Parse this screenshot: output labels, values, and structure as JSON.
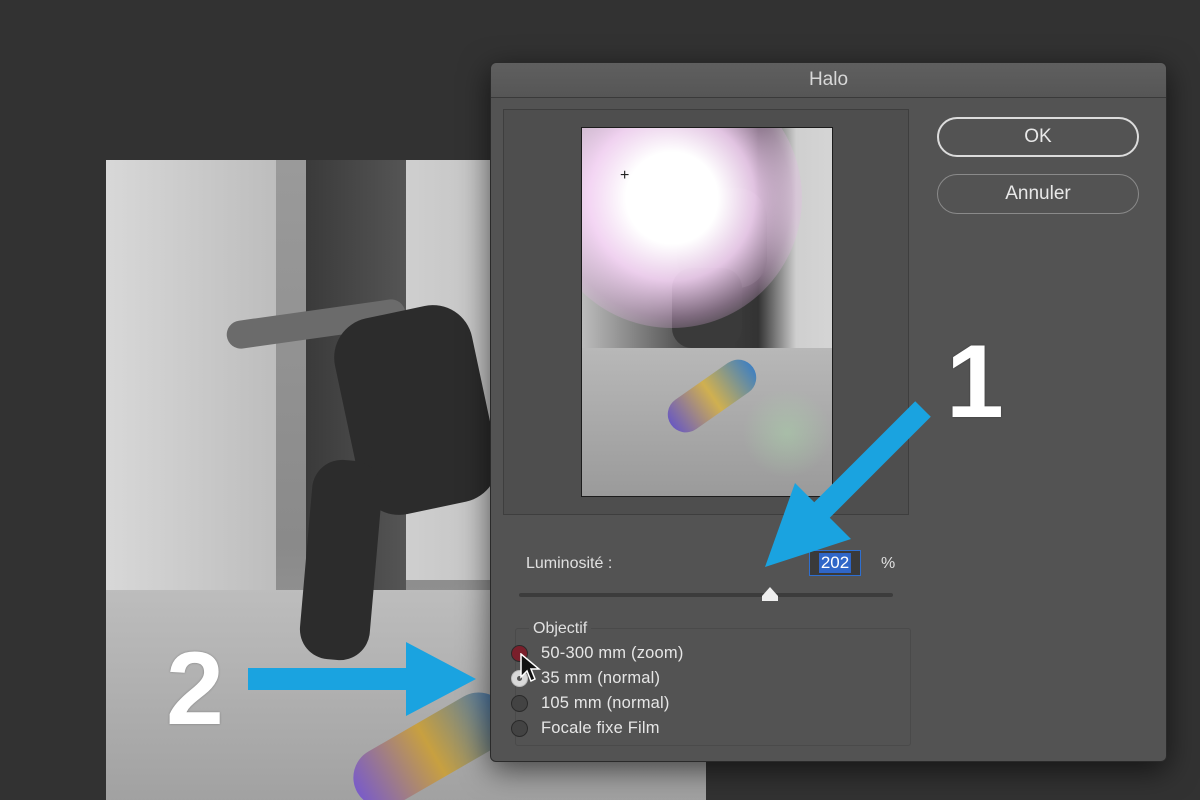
{
  "dialog": {
    "title": "Halo",
    "ok_label": "OK",
    "cancel_label": "Annuler",
    "brightness_label": "Luminosité :",
    "brightness_value": "202",
    "brightness_unit": "%",
    "brightness_slider_level": 0.67,
    "lens_group_title": "Objectif",
    "lens_options": [
      {
        "label": "50-300 mm (zoom)",
        "state": "pressed"
      },
      {
        "label": "35 mm (normal)",
        "state": "checked"
      },
      {
        "label": "105 mm  (normal)",
        "state": "unchecked"
      },
      {
        "label": "Focale fixe Film",
        "state": "unchecked"
      }
    ]
  },
  "annotations": {
    "marker_1": "1",
    "marker_2": "2",
    "arrow_color": "#1aa3e0"
  },
  "icons": {
    "crosshair": "crosshair-icon",
    "cursor": "mouse-pointer-icon"
  }
}
